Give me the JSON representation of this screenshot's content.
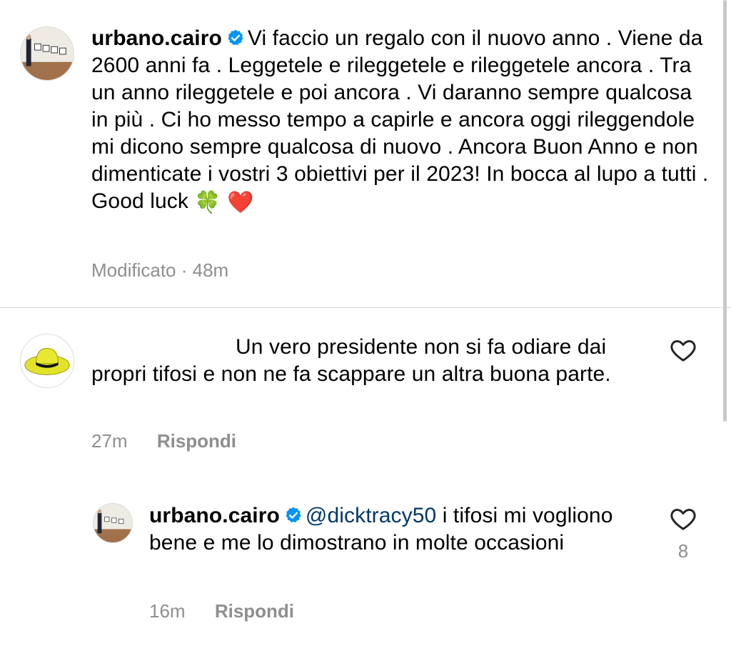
{
  "caption": {
    "username": "urbano.cairo",
    "verified": true,
    "text": "Vi faccio un regalo con il nuovo anno . Viene da 2600 anni fa . Leggetele e rileggetele e rileggetele ancora . Tra un anno rileggetele e poi ancora . Vi daranno sempre qualcosa in più . Ci ho messo tempo a capirle e ancora oggi rileggendole mi dicono sempre qualcosa di nuovo . Ancora Buon Anno e non dimenticate i vostri 3 obiettivi per il 2023! In bocca al lupo a tutti . Good luck",
    "emoji_1": "🍀",
    "emoji_2": "❤️",
    "edited_label": "Modificato",
    "separator": "·",
    "time": "48m"
  },
  "comment": {
    "text": "Un vero presidente non si fa odiare dai propri tifosi e non ne fa scappare un altra buona parte.",
    "time": "27m",
    "reply_label": "Rispondi"
  },
  "reply": {
    "username": "urbano.cairo",
    "verified": true,
    "mention": "@dicktracy50",
    "text": "i tifosi mi vogliono bene e me lo dimostrano in molte occasioni",
    "time": "16m",
    "reply_label": "Rispondi",
    "likes": "8"
  },
  "icons": {
    "verified": "verified-badge-icon",
    "like": "heart-outline-icon"
  },
  "colors": {
    "verified_blue": "#0095f6",
    "mention": "#00376b",
    "secondary_text": "#8e8e8e",
    "divider": "#dbdbdb"
  }
}
